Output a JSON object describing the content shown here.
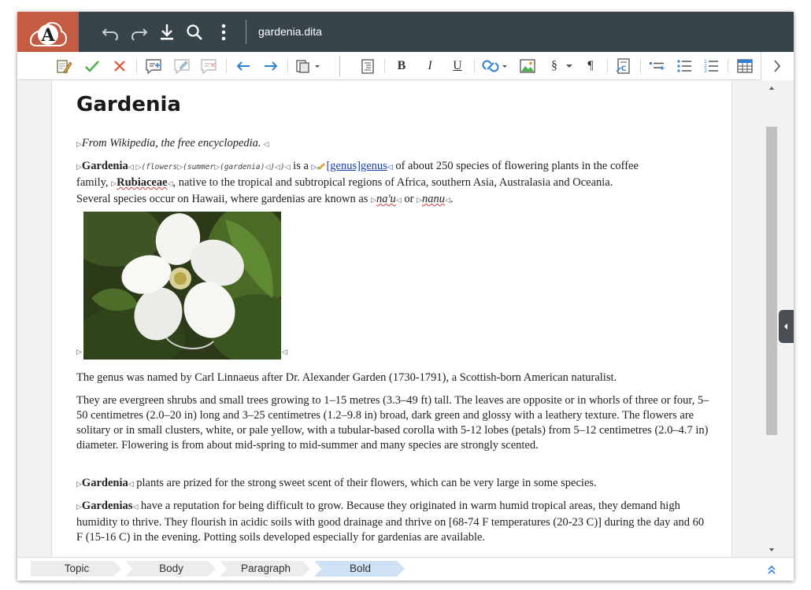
{
  "app": {
    "logo_letter": "A",
    "document_title": "gardenia.dita"
  },
  "topbar": {
    "icons": [
      "undo-icon",
      "redo-icon",
      "download-icon",
      "search-icon",
      "more-vertical-icon"
    ]
  },
  "toolbar": {
    "bold_label": "B",
    "italic_label": "I",
    "underline_label": "U",
    "section_label": "§",
    "pilcrow_label": "¶"
  },
  "document": {
    "title": "Gardenia",
    "p1": "From Wikipedia, the free encyclopedia.",
    "p2": {
      "term": "Gardenia",
      "code": "(flowers",
      "code2": "(summer",
      "code3": "(gardenia)",
      "code_close": ")",
      "code_close2": ")",
      "is_a": " is a ",
      "link_bracket": "[genus]",
      "link_text": "genus",
      "after_link": " of about 250 species of flowering plants in the coffee",
      "line2_start": "family, ",
      "family": "Rubiaceae",
      "line2_rest": ", native to the tropical and subtropical regions of Africa, southern Asia, Australasia and Oceania.",
      "line3": "Several species occur on Hawaii, where gardenias are known as ",
      "naau": "na'u",
      "or": " or ",
      "nanu": "nanu",
      "period": "."
    },
    "p3": "The genus was named by Carl Linnaeus after Dr. Alexander Garden (1730-1791), a Scottish-born American naturalist.",
    "p4": "They are evergreen shrubs and small trees growing to 1–15 metres (3.3–49 ft) tall. The leaves are opposite or in whorls of three or four, 5–50 centimetres (2.0–20 in) long and 3–25 centimetres (1.2–9.8 in) broad, dark green and glossy with a leathery texture. The flowers are solitary or in small clusters, white, or pale yellow, with a tubular-based corolla with 5-12 lobes (petals) from 5–12 centimetres (2.0–4.7 in) diameter. Flowering is from about mid-spring to mid-summer and many species are strongly scented.",
    "p5_term": "Gardenia",
    "p5_rest": " plants are prized for the strong sweet scent of their flowers, which can be very large in some species.",
    "p6_term": "Gardenias",
    "p6_rest": " have a reputation for being difficult to grow. Because they originated in warm humid tropical areas, they demand high humidity to thrive. They flourish in acidic soils with good drainage and thrive on [68-74 F temperatures (20-23 C)] during the day and 60 F (15-16 C) in the evening. Potting soils developed especially for gardenias are available."
  },
  "breadcrumb": {
    "items": [
      "Topic",
      "Body",
      "Paragraph",
      "Bold"
    ],
    "active_index": 3,
    "active_color": "#cfe1f5",
    "inactive_color": "#ececec"
  },
  "colors": {
    "topbar": "#37444c",
    "logo_bg": "#c45b43",
    "accept": "#4caf50",
    "reject": "#e0533c",
    "link": "#1a3faa"
  }
}
